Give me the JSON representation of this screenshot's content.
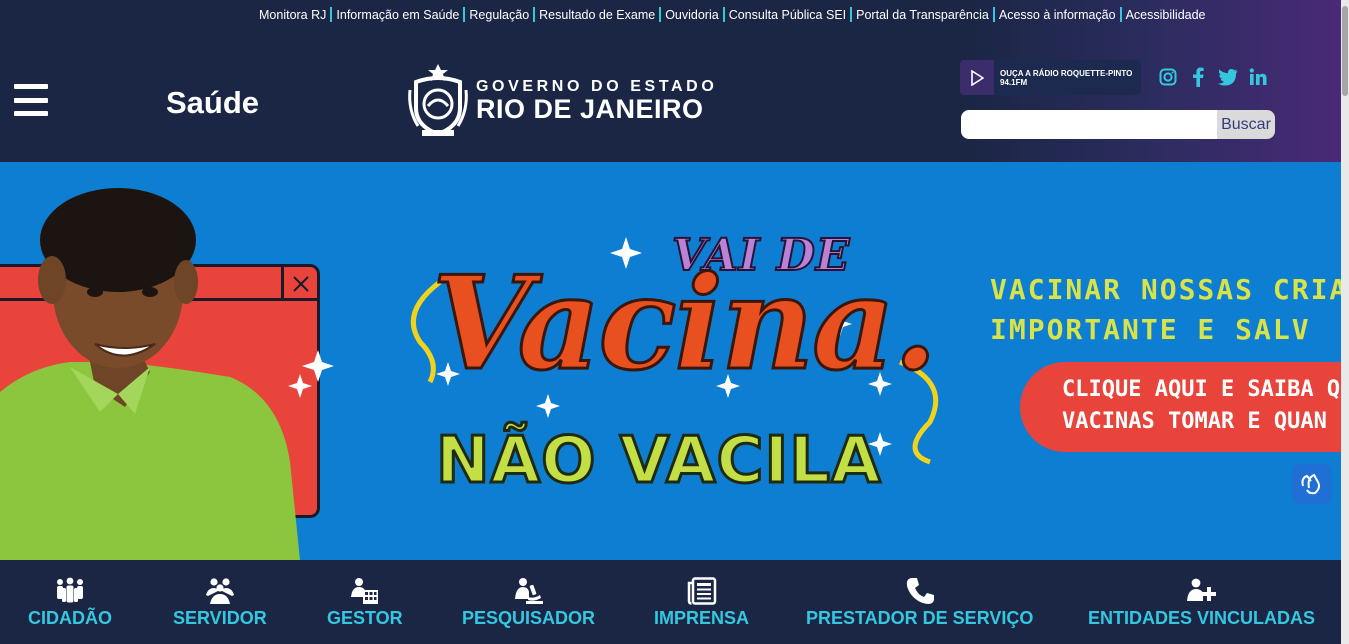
{
  "top_links": [
    "Monitora RJ",
    "Informação em Saúde",
    "Regulação",
    "Resultado de Exame",
    "Ouvidoria",
    "Consulta Pública SEI",
    "Portal da Transparência",
    "Acesso à informação",
    "Acessibilidade"
  ],
  "header": {
    "section_title": "Saúde",
    "logo_line1": "GOVERNO DO ESTADO",
    "logo_line2": "RIO DE JANEIRO",
    "radio_line1": "OUÇA A RÁDIO ROQUETTE-PINTO",
    "radio_line2": "94.1FM",
    "search_button": "Buscar",
    "search_value": ""
  },
  "social": [
    "instagram-icon",
    "facebook-icon",
    "twitter-icon",
    "linkedin-icon"
  ],
  "banner": {
    "headline_top": "VAI DE",
    "headline_main": "Vacina.",
    "headline_bottom": "NÃO VACILA",
    "promo_line1": "VACINAR NOSSAS CRIA",
    "promo_line2": "IMPORTANTE E SALV",
    "cta_line1": "CLIQUE AQUI E SAIBA QUA",
    "cta_line2": "VACINAS TOMAR E QUAN"
  },
  "bottom_nav": [
    {
      "label": "CIDADÃO",
      "icon": "people-group-icon"
    },
    {
      "label": "SERVIDOR",
      "icon": "team-icon"
    },
    {
      "label": "GESTOR",
      "icon": "manager-building-icon"
    },
    {
      "label": "PESQUISADOR",
      "icon": "microscope-icon"
    },
    {
      "label": "IMPRENSA",
      "icon": "newspaper-icon"
    },
    {
      "label": "PRESTADOR DE SERVIÇO",
      "icon": "phone-icon"
    },
    {
      "label": "ENTIDADES VINCULADAS",
      "icon": "user-plus-icon"
    }
  ],
  "colors": {
    "header_bg": "#1b2645",
    "accent": "#36c7e0",
    "banner_bg": "#0e7ed3",
    "banner_red": "#e8443c",
    "banner_yellow": "#d8e34a"
  }
}
